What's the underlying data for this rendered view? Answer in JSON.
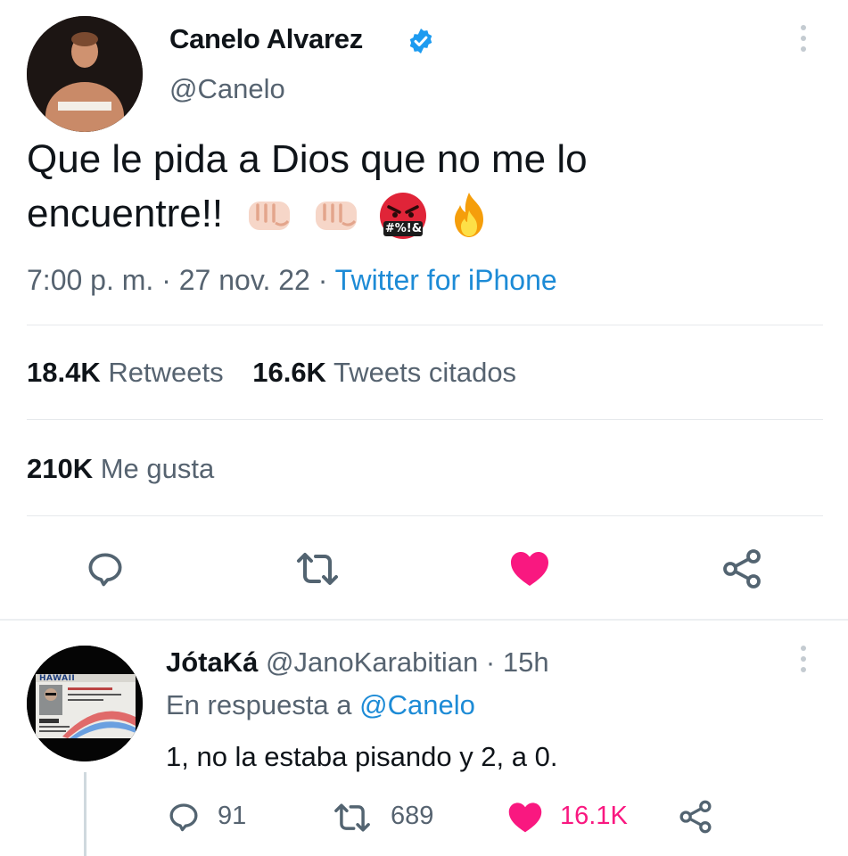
{
  "tweet": {
    "author_name": "Canelo Alvarez",
    "handle": "@Canelo",
    "text_line1": "Que le pida a Dios que no me lo",
    "text_line2": "encuentre!!",
    "meta_time": "7:00 p. m. · 27 nov. 22 ·",
    "meta_source": "Twitter for iPhone",
    "retweets_count": "18.4K",
    "retweets_label": "Retweets",
    "quotes_count": "16.6K",
    "quotes_label": "Tweets citados",
    "likes_count": "210K",
    "likes_label": "Me gusta",
    "cursing_face_text": "#%!&"
  },
  "reply": {
    "author_name": "JótaKá",
    "handle_time": "@JanoKarabitian · 15h",
    "in_reply_prefix": "En respuesta a",
    "in_reply_handle": "@Canelo",
    "text": "1, no la estaba pisando y 2, a 0.",
    "replies_count": "91",
    "retweets_count": "689",
    "likes_count": "16.1K",
    "license_state": "HAWAII"
  },
  "colors": {
    "like_pink": "#f91880",
    "link_blue": "#1d8bd6",
    "verified_blue": "#1d9bf0",
    "muted_text": "#566370"
  },
  "icons": [
    "verified-badge-icon",
    "more-options-icon",
    "reply-icon",
    "retweet-icon",
    "heart-filled-icon",
    "share-icon",
    "fist-emoji",
    "cursing-face-emoji",
    "fire-emoji"
  ]
}
